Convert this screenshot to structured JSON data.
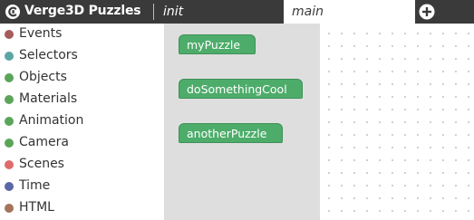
{
  "header": {
    "app_title": "Verge3D Puzzles",
    "logo_icon": "verge3d-logo-icon",
    "tabs": [
      {
        "label": "init",
        "active": false
      },
      {
        "label": "main",
        "active": true
      }
    ],
    "add_tab_icon": "plus-circle-icon"
  },
  "sidebar": {
    "categories": [
      {
        "label": "Events",
        "color": "#a55b5b"
      },
      {
        "label": "Selectors",
        "color": "#5ba5a5"
      },
      {
        "label": "Objects",
        "color": "#5ba55b"
      },
      {
        "label": "Materials",
        "color": "#5ba55b"
      },
      {
        "label": "Animation",
        "color": "#5ba55b"
      },
      {
        "label": "Camera",
        "color": "#5ba55b"
      },
      {
        "label": "Scenes",
        "color": "#e06b6b"
      },
      {
        "label": "Time",
        "color": "#5b67a5"
      },
      {
        "label": "HTML",
        "color": "#a5745b"
      }
    ]
  },
  "flyout": {
    "blocks": [
      {
        "label": "myPuzzle"
      },
      {
        "label": "doSomethingCool"
      },
      {
        "label": "anotherPuzzle"
      }
    ]
  },
  "colors": {
    "topbar": "#3a3a3a",
    "block_fill": "#4dac6a",
    "flyout_bg": "#dedede"
  }
}
